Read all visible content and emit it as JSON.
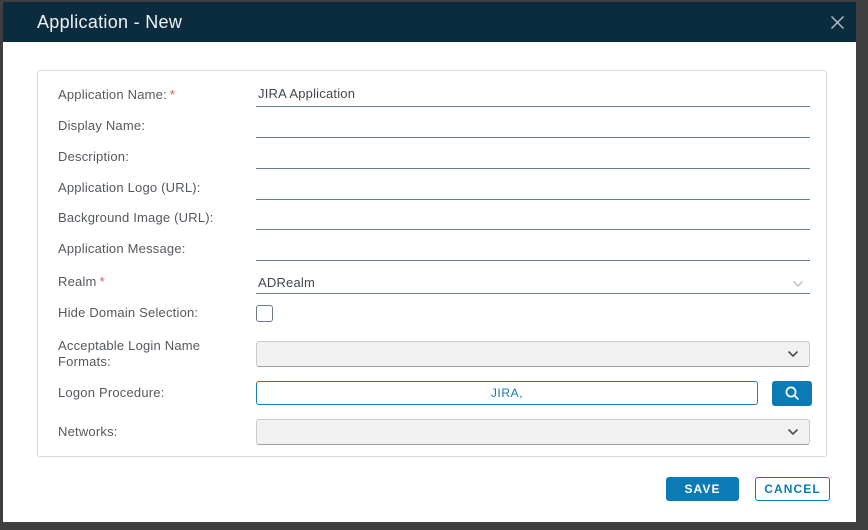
{
  "window": {
    "title": "Application - New"
  },
  "colors": {
    "header_background": "#0b2b3e",
    "accent_blue": "#0c7bb5",
    "required_red": "#e0564c",
    "input_underline": "#657e8d"
  },
  "icons": {
    "close": "✕",
    "search": "⌕",
    "chevron_down": "⌄"
  },
  "form": {
    "required_marker": "*",
    "fields": [
      {
        "label": "Application Name:",
        "required": true,
        "type": "text",
        "value": "JIRA Application"
      },
      {
        "label": "Display Name:",
        "required": false,
        "type": "text",
        "value": ""
      },
      {
        "label": "Description:",
        "required": false,
        "type": "text",
        "value": ""
      },
      {
        "label": "Application Logo (URL):",
        "required": false,
        "type": "text",
        "value": ""
      },
      {
        "label": "Background Image (URL):",
        "required": false,
        "type": "text",
        "value": ""
      },
      {
        "label": "Application Message:",
        "required": false,
        "type": "text",
        "value": ""
      },
      {
        "label": "Realm",
        "required": true,
        "type": "dropdown",
        "value": "ADRealm"
      },
      {
        "label": "Hide Domain Selection:",
        "required": false,
        "type": "checkbox",
        "checked": false
      },
      {
        "label": "Acceptable Login Name Formats:",
        "required": false,
        "type": "dropdown",
        "value": ""
      },
      {
        "label": "Logon Procedure:",
        "required": false,
        "type": "search-input",
        "value": "JIRA,"
      },
      {
        "label": "Networks:",
        "required": false,
        "type": "dropdown",
        "value": ""
      }
    ]
  },
  "footer": {
    "save_label": "SAVE",
    "cancel_label": "CANCEL"
  }
}
